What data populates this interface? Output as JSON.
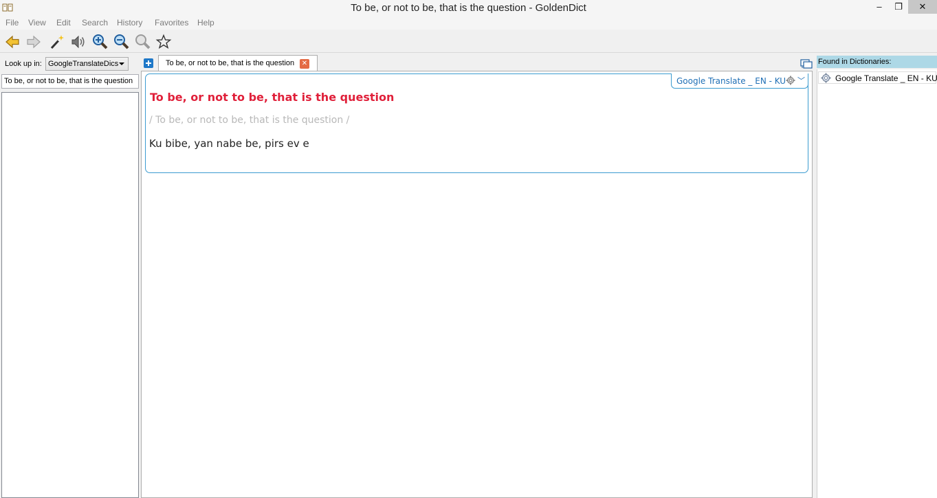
{
  "window": {
    "title": "To be, or not to be, that is the question - GoldenDict",
    "minimize_glyph": "–",
    "maximize_glyph": "❐",
    "close_glyph": "✕"
  },
  "menu": {
    "items": [
      "File",
      "View",
      "Edit",
      "Search",
      "History",
      "Favorites",
      "Help"
    ]
  },
  "toolbar": {
    "buttons": [
      "back-icon",
      "forward-icon",
      "magic-wand-icon",
      "speaker-icon",
      "zoom-in-icon",
      "zoom-out-icon",
      "zoom-reset-icon",
      "favorite-star-icon"
    ]
  },
  "lookup": {
    "label": "Look up in:",
    "selected_group": "GoogleTranslateDics"
  },
  "search": {
    "value": "To be, or not to be, that is the question"
  },
  "tabs": [
    {
      "label": "To be, or not to be, that is the question",
      "close_glyph": "✕"
    }
  ],
  "article": {
    "dictionary_name": "Google Translate _ EN - KU",
    "headword": "To be, or not to be, that is the question",
    "transcription": "/ To be, or not to be, that is the question /",
    "translation": "Ku bibe, yan nabe be, pirs ev e"
  },
  "found": {
    "header": "Found in Dictionaries:",
    "items": [
      "Google Translate _ EN - KU"
    ]
  },
  "colors": {
    "headword": "#e0203a",
    "article_border": "#3a9bd0",
    "found_header_bg": "#add8e6",
    "dict_name": "#1f6fb5"
  }
}
